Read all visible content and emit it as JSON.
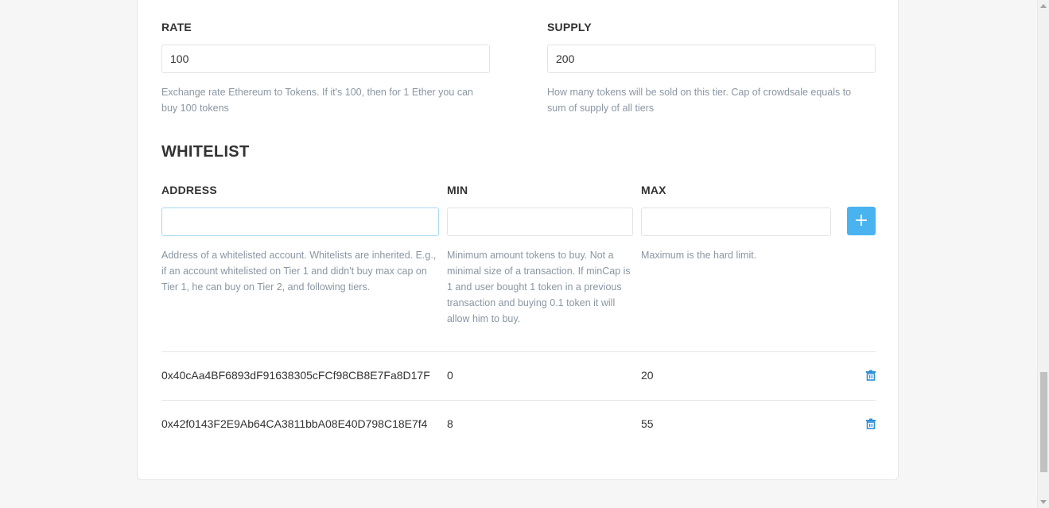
{
  "tier": {
    "rate": {
      "label": "RATE",
      "value": "100",
      "hint": "Exchange rate Ethereum to Tokens. If it's 100, then for 1 Ether you can buy 100 tokens"
    },
    "supply": {
      "label": "SUPPLY",
      "value": "200",
      "hint": "How many tokens will be sold on this tier. Cap of crowdsale equals to sum of supply of all tiers"
    }
  },
  "whitelist": {
    "title": "WHITELIST",
    "address": {
      "label": "ADDRESS",
      "value": "",
      "hint": "Address of a whitelisted account. Whitelists are inherited. E.g., if an account whitelisted on Tier 1 and didn't buy max cap on Tier 1, he can buy on Tier 2, and following tiers."
    },
    "min": {
      "label": "MIN",
      "value": "",
      "hint": "Minimum amount tokens to buy. Not a minimal size of a transaction. If minCap is 1 and user bought 1 token in a previous transaction and buying 0.1 token it will allow him to buy."
    },
    "max": {
      "label": "MAX",
      "value": "",
      "hint": "Maximum is the hard limit."
    },
    "add_button": "+",
    "rows": [
      {
        "address": "0x40cAa4BF6893dF91638305cFCf98CB8E7Fa8D17F",
        "min": "0",
        "max": "20"
      },
      {
        "address": "0x42f0143F2E9Ab64CA3811bbA08E40D798C18E7f4",
        "min": "8",
        "max": "55"
      }
    ]
  },
  "colors": {
    "accent": "#49b3f0",
    "trash_icon": "#2d8ed6",
    "hint_text": "#8a96a3"
  },
  "icons": {
    "add": "plus-icon",
    "delete": "trash-icon"
  }
}
